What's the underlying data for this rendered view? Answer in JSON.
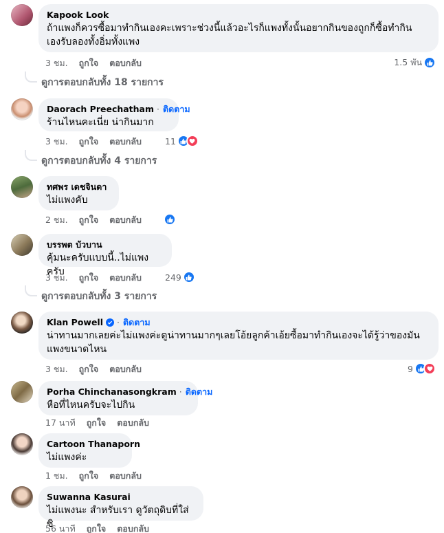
{
  "comments": [
    {
      "author": "Kapook Look",
      "follow": "",
      "text": [
        "ถ้าแพงก็ควรซื้อมาทำกินเองคะเพราะช่วงนี้แล้วอะไรก็แพงทั้งนั้นอยากกินของถูกก็ซื้อทำกิน",
        "เองรับลองทั้งอิ่มทั้งแพง"
      ],
      "time": "3 ชม.",
      "like": "ถูกใจ",
      "reply": "ตอบกลับ",
      "reaction_count": "1.5 พัน",
      "view_replies": "ดูการตอบกลับทั้ง 18 รายการ"
    },
    {
      "author": "Daorach Preechatham",
      "follow": "ติดตาม",
      "text": [
        "ร้านไหนคะเนี่ย น่ากินมาก"
      ],
      "time": "3 ชม.",
      "like": "ถูกใจ",
      "reply": "ตอบกลับ",
      "reaction_count": "11",
      "view_replies": "ดูการตอบกลับทั้ง 4 รายการ"
    },
    {
      "author": "ทศพร เดชจินดา",
      "follow": "",
      "text": [
        "ไม่แพงคับ"
      ],
      "time": "2 ชม.",
      "like": "ถูกใจ",
      "reply": "ตอบกลับ",
      "reaction_count": ""
    },
    {
      "author": "บรรพต บัวบาน",
      "follow": "",
      "text": [
        "คุ้มนะครับแบบนี้..ไม่แพงครับ"
      ],
      "time": "3 ชม.",
      "like": "ถูกใจ",
      "reply": "ตอบกลับ",
      "reaction_count": "249",
      "view_replies": "ดูการตอบกลับทั้ง 3 รายการ"
    },
    {
      "author": "Klan Powell",
      "follow": "ติดตาม",
      "verified": true,
      "text": [
        "น่าทานมากเลยค่ะไม่แพงค่ะดูน่าทานมากๆเลยโอ้ยลูกค้าเอ้ยซื้อมาทำกินเองจะได้รู้ว่าของมัน",
        "แพงขนาดไหน"
      ],
      "time": "3 ชม.",
      "like": "ถูกใจ",
      "reply": "ตอบกลับ",
      "reaction_count": "9"
    },
    {
      "author": "Porha Chinchanasongkram",
      "follow": "ติดตาม",
      "text": [
        "หือที่ไหนครับจะไปกิน"
      ],
      "time": "17 นาที",
      "like": "ถูกใจ",
      "reply": "ตอบกลับ"
    },
    {
      "author": "Cartoon Thanaporn",
      "follow": "",
      "text": [
        "ไม่แพงค่ะ"
      ],
      "time": "1 ชม.",
      "like": "ถูกใจ",
      "reply": "ตอบกลับ"
    },
    {
      "author": "Suwanna Kasurai",
      "follow": "",
      "text": [
        "ไม่แพงนะ สำหรับเรา ดูวัตถุดิบที่ใส่ซิ"
      ],
      "time": "56 นาที",
      "like": "ถูกใจ",
      "reply": "ตอบกลับ"
    }
  ],
  "colors": {
    "like_blue": "#1877f2",
    "love_red": "#f33e58",
    "bubble": "#f0f2f5",
    "follow": "#0866ff",
    "meta": "#65676b"
  },
  "icons": {
    "like": "thumbs-up-icon",
    "love": "heart-icon",
    "verified": "verified-badge-icon"
  }
}
